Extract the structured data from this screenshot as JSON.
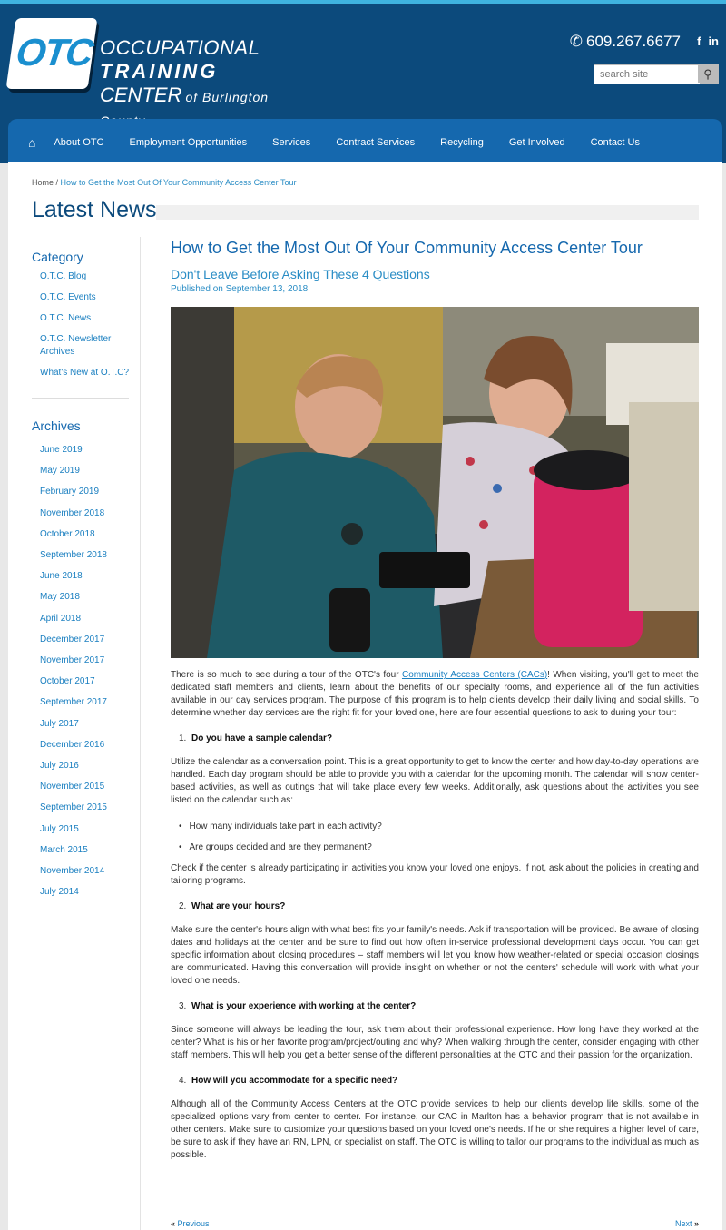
{
  "brand": {
    "logo_letters": "OTC",
    "line1": "OCCUPATIONAL",
    "line2": "TRAINING",
    "line3": "CENTER",
    "line3_suffix": "of Burlington County",
    "phone": "609.267.6677",
    "social_facebook": "f",
    "social_linkedin": "in"
  },
  "search": {
    "placeholder": "search site"
  },
  "nav": {
    "items": [
      "About OTC",
      "Employment Opportunities",
      "Services",
      "Contract Services",
      "Recycling",
      "Get Involved",
      "Contact Us"
    ]
  },
  "breadcrumb": {
    "home": "Home",
    "sep": " / ",
    "current": "How to Get the Most Out Of Your Community Access Center Tour"
  },
  "page_title": "Latest News",
  "sidebar": {
    "category_heading": "Category",
    "categories": [
      "O.T.C. Blog",
      "O.T.C. Events",
      "O.T.C. News",
      "O.T.C. Newsletter Archives",
      "What's New at O.T.C?"
    ],
    "archives_heading": "Archives",
    "archives": [
      "June 2019",
      "May 2019",
      "February 2019",
      "November 2018",
      "October 2018",
      "September 2018",
      "June 2018",
      "May 2018",
      "April 2018",
      "December 2017",
      "November 2017",
      "October 2017",
      "September 2017",
      "July 2017",
      "December 2016",
      "July 2016",
      "November 2015",
      "September 2015",
      "July 2015",
      "March 2015",
      "November 2014",
      "July 2014"
    ]
  },
  "article": {
    "title": "How to Get the Most Out Of Your Community Access Center Tour",
    "subtitle": "Don't Leave Before Asking These 4 Questions",
    "published": "Published on September 13, 2018",
    "intro_before": "There is so much to see during a tour of the OTC's four ",
    "intro_link": "Community Access Centers (CACs)",
    "intro_after": "! When visiting, you'll get to meet the dedicated staff members and clients, learn about the benefits of our specialty rooms, and experience all of the fun activities available in our day services program. The purpose of this program is to help clients develop their daily living and social skills. To determine whether day services are the right fit for your loved one, here are four essential questions to ask to during your tour:",
    "q1_num": "1.",
    "q1": "Do you have a sample calendar?",
    "p1": "Utilize the calendar as a conversation point. This is a great opportunity to get to know the center and how day-to-day operations are handled. Each day program should be able to provide you with a calendar for the upcoming month. The calendar will show center-based activities, as well as outings that will take place every few weeks. Additionally, ask questions about the activities you see listed on the calendar such as:",
    "bullets": [
      "How many individuals take part in each activity?",
      "Are groups decided and are they permanent?"
    ],
    "p1b": "Check if the center is already participating in activities you know your loved one enjoys. If not, ask about the policies in creating and tailoring programs.",
    "q2_num": "2.",
    "q2": "What are your hours?",
    "p2": "Make sure the center's hours align with what best fits your family's needs. Ask if transportation will be provided. Be aware of closing dates and holidays at the center and be sure to find out how often in-service professional development days occur. You can get specific information about closing procedures – staff members will let you know how weather-related or special occasion closings are communicated. Having this conversation will provide insight on whether or not the centers' schedule will work with what your loved one needs.",
    "q3_num": "3.",
    "q3": "What is your experience with working at the center?",
    "p3": "Since someone will always be leading the tour, ask them about their professional experience. How long have they worked at the center? What is his or her favorite program/project/outing and why? When walking through the center, consider engaging with other staff members. This will help you get a better sense of the different personalities at the OTC and their passion for the organization.",
    "q4_num": "4.",
    "q4": "How will you accommodate for a specific need?",
    "p4": "Although all of the Community Access Centers at the OTC provide services to help our clients develop life skills, some of the specialized options vary from center to center. For instance, our CAC in Marlton has a behavior program that is not available in other centers. Make sure to customize your questions based on your loved one's needs. If he or she requires a higher level of care, be sure to ask if they have an RN, LPN, or specialist on staff. The OTC is willing to tailor our programs to the individual as much as possible."
  },
  "pager": {
    "prev_marker": "«",
    "prev": "Previous",
    "next": "Next",
    "next_marker": "»"
  }
}
